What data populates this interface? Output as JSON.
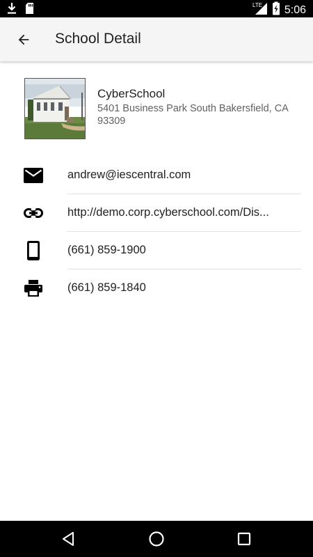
{
  "status_bar": {
    "time": "5:06",
    "network": "LTE",
    "icons": [
      "download-icon",
      "sd-card-icon",
      "signal-icon",
      "battery-charging-icon"
    ]
  },
  "app_bar": {
    "title": "School Detail",
    "back_icon": "arrow-back-icon"
  },
  "school": {
    "name": "CyberSchool",
    "address": "5401 Business Park South Bakersfield, CA 93309",
    "photo": "school-building-photo"
  },
  "contacts": [
    {
      "type": "email",
      "icon": "email-icon",
      "value": "andrew@iescentral.com"
    },
    {
      "type": "link",
      "icon": "link-icon",
      "value": "http://demo.corp.cyberschool.com/Dis..."
    },
    {
      "type": "phone",
      "icon": "phone-icon",
      "value": "(661) 859-1900"
    },
    {
      "type": "fax",
      "icon": "fax-icon",
      "value": "(661) 859-1840"
    }
  ],
  "nav_bar": {
    "buttons": [
      "back-nav-icon",
      "home-nav-icon",
      "recents-nav-icon"
    ]
  }
}
